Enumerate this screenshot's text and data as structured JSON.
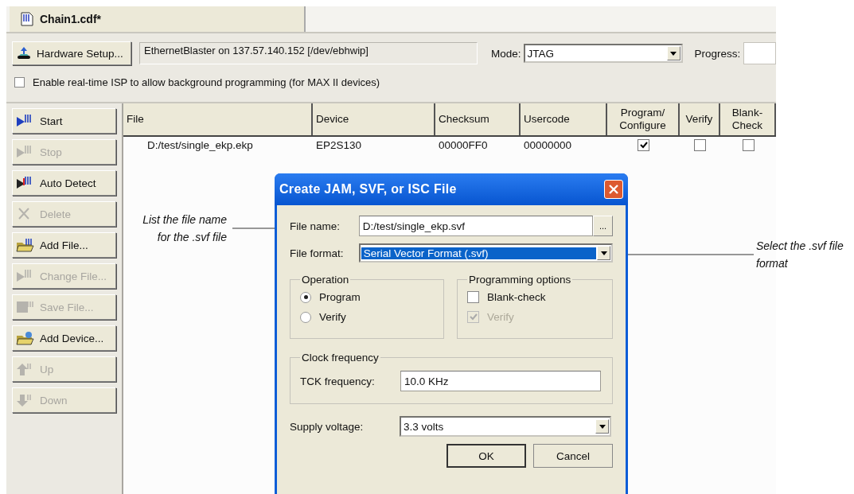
{
  "document_tab": {
    "title": "Chain1.cdf*"
  },
  "toolbar": {
    "hardware_button": "Hardware Setup...",
    "hardware_status": "EthernetBlaster on 137.57.140.152 [/dev/ebhwip]",
    "mode_label": "Mode:",
    "mode_value": "JTAG",
    "progress_label": "Progress:"
  },
  "isp_option": {
    "label": "Enable real-time ISP to allow background programming (for MAX II devices)",
    "checked": false
  },
  "side_buttons": [
    {
      "label": "Start",
      "disabled": false
    },
    {
      "label": "Stop",
      "disabled": true
    },
    {
      "label": "Auto Detect",
      "disabled": false
    },
    {
      "label": "Delete",
      "disabled": true
    },
    {
      "label": "Add File...",
      "disabled": false
    },
    {
      "label": "Change File...",
      "disabled": true
    },
    {
      "label": "Save File...",
      "disabled": true
    },
    {
      "label": "Add Device...",
      "disabled": false
    },
    {
      "label": "Up",
      "disabled": true
    },
    {
      "label": "Down",
      "disabled": true
    }
  ],
  "table": {
    "columns": [
      {
        "label": "File",
        "kind": "text"
      },
      {
        "label": "Device",
        "kind": "text"
      },
      {
        "label": "Checksum",
        "kind": "text"
      },
      {
        "label": "Usercode",
        "kind": "text"
      },
      {
        "label": "Program/\nConfigure",
        "kind": "check"
      },
      {
        "label": "Verify",
        "kind": "check"
      },
      {
        "label": "Blank-\nCheck",
        "kind": "check"
      }
    ],
    "rows": [
      {
        "cells": [
          "D:/test/single_ekp.ekp",
          "EP2S130",
          "00000FF0",
          "00000000"
        ],
        "checks": [
          true,
          false,
          false
        ]
      }
    ]
  },
  "dialog": {
    "title": "Create JAM, SVF, or ISC File",
    "file_name_label": "File name:",
    "file_name_value": "D:/test/single_ekp.svf",
    "browse_button": "...",
    "file_format_label": "File format:",
    "file_format_value": "Serial Vector Format (.svf)",
    "operation": {
      "title": "Operation",
      "options": [
        {
          "label": "Program",
          "selected": true
        },
        {
          "label": "Verify",
          "selected": false
        }
      ]
    },
    "programming_options": {
      "title": "Programming options",
      "options": [
        {
          "label": "Blank-check",
          "checked": false,
          "disabled": false
        },
        {
          "label": "Verify",
          "checked": true,
          "disabled": true
        }
      ]
    },
    "clock": {
      "title": "Clock frequency",
      "label": "TCK frequency:",
      "value": "10.0 KHz"
    },
    "supply_label": "Supply voltage:",
    "supply_value": "3.3 volts",
    "buttons": [
      {
        "label": "OK",
        "default": true
      },
      {
        "label": "Cancel",
        "default": false
      }
    ]
  },
  "annotations": [
    {
      "text": "List the file name\nfor the .svf file",
      "kind": "left"
    },
    {
      "text": "Select the .svf file\nformat",
      "kind": "right"
    }
  ]
}
